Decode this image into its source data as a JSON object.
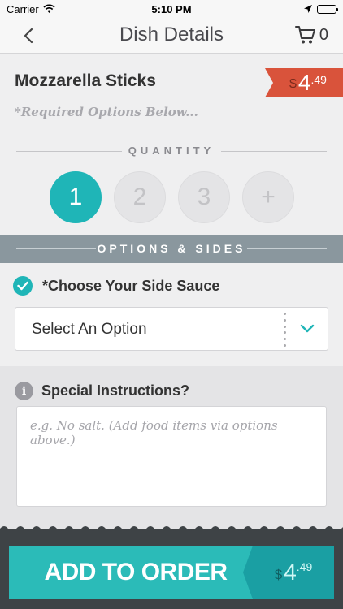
{
  "status_bar": {
    "carrier": "Carrier",
    "time": "5:10 PM"
  },
  "nav": {
    "title": "Dish Details",
    "cart_count": "0"
  },
  "dish": {
    "name": "Mozzarella Sticks",
    "price_currency": "$",
    "price_whole": "4",
    "price_cents": ".49",
    "required_note": "*Required Options Below..."
  },
  "quantity": {
    "label": "QUANTITY",
    "options": [
      "1",
      "2",
      "3",
      "+"
    ],
    "selected": "1"
  },
  "options_section": {
    "label": "OPTIONS & SIDES"
  },
  "side_sauce": {
    "title": "*Choose Your Side Sauce",
    "selected_value": "Select An Option"
  },
  "special_instructions": {
    "title": "Special Instructions?",
    "placeholder": "e.g. No salt. (Add food items via options above.)",
    "value": ""
  },
  "add_to_order": {
    "label": "ADD TO ORDER",
    "total_currency": "$",
    "total_whole": "4",
    "total_cents": ".49"
  },
  "colors": {
    "accent": "#1fb5b7",
    "price_tag": "#d9533b",
    "options_band": "#8a979e",
    "footer": "#3e4346"
  },
  "icons": {
    "back": "chevron-left-icon",
    "cart": "cart-icon",
    "wifi": "wifi-icon",
    "location": "location-arrow-icon",
    "battery": "battery-icon",
    "check": "checkmark-icon",
    "dropdown": "chevron-down-icon",
    "info": "info-icon"
  }
}
